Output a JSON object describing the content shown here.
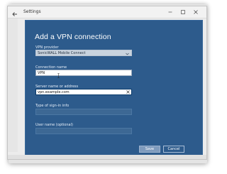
{
  "window": {
    "title": "Settings",
    "icons": {
      "back": "back-arrow-icon",
      "minimize": "minimize-icon",
      "maximize": "maximize-icon",
      "close": "close-icon"
    }
  },
  "dialog": {
    "title": "Add a VPN connection",
    "vpn_provider": {
      "label": "VPN provider",
      "value": "SonicWALL Mobile Connect"
    },
    "connection_name": {
      "label": "Connection name",
      "value": "VPN"
    },
    "server": {
      "label": "Server name or address",
      "value": "vpn.example.com"
    },
    "sign_in_type": {
      "label": "Type of sign-in info",
      "value": ""
    },
    "username": {
      "label": "User name (optional)",
      "value": ""
    },
    "buttons": {
      "save": "Save",
      "cancel": "Cancel"
    }
  },
  "colors": {
    "dialog_bg": "#2d5b8c",
    "accent": "#7f9bbd"
  }
}
